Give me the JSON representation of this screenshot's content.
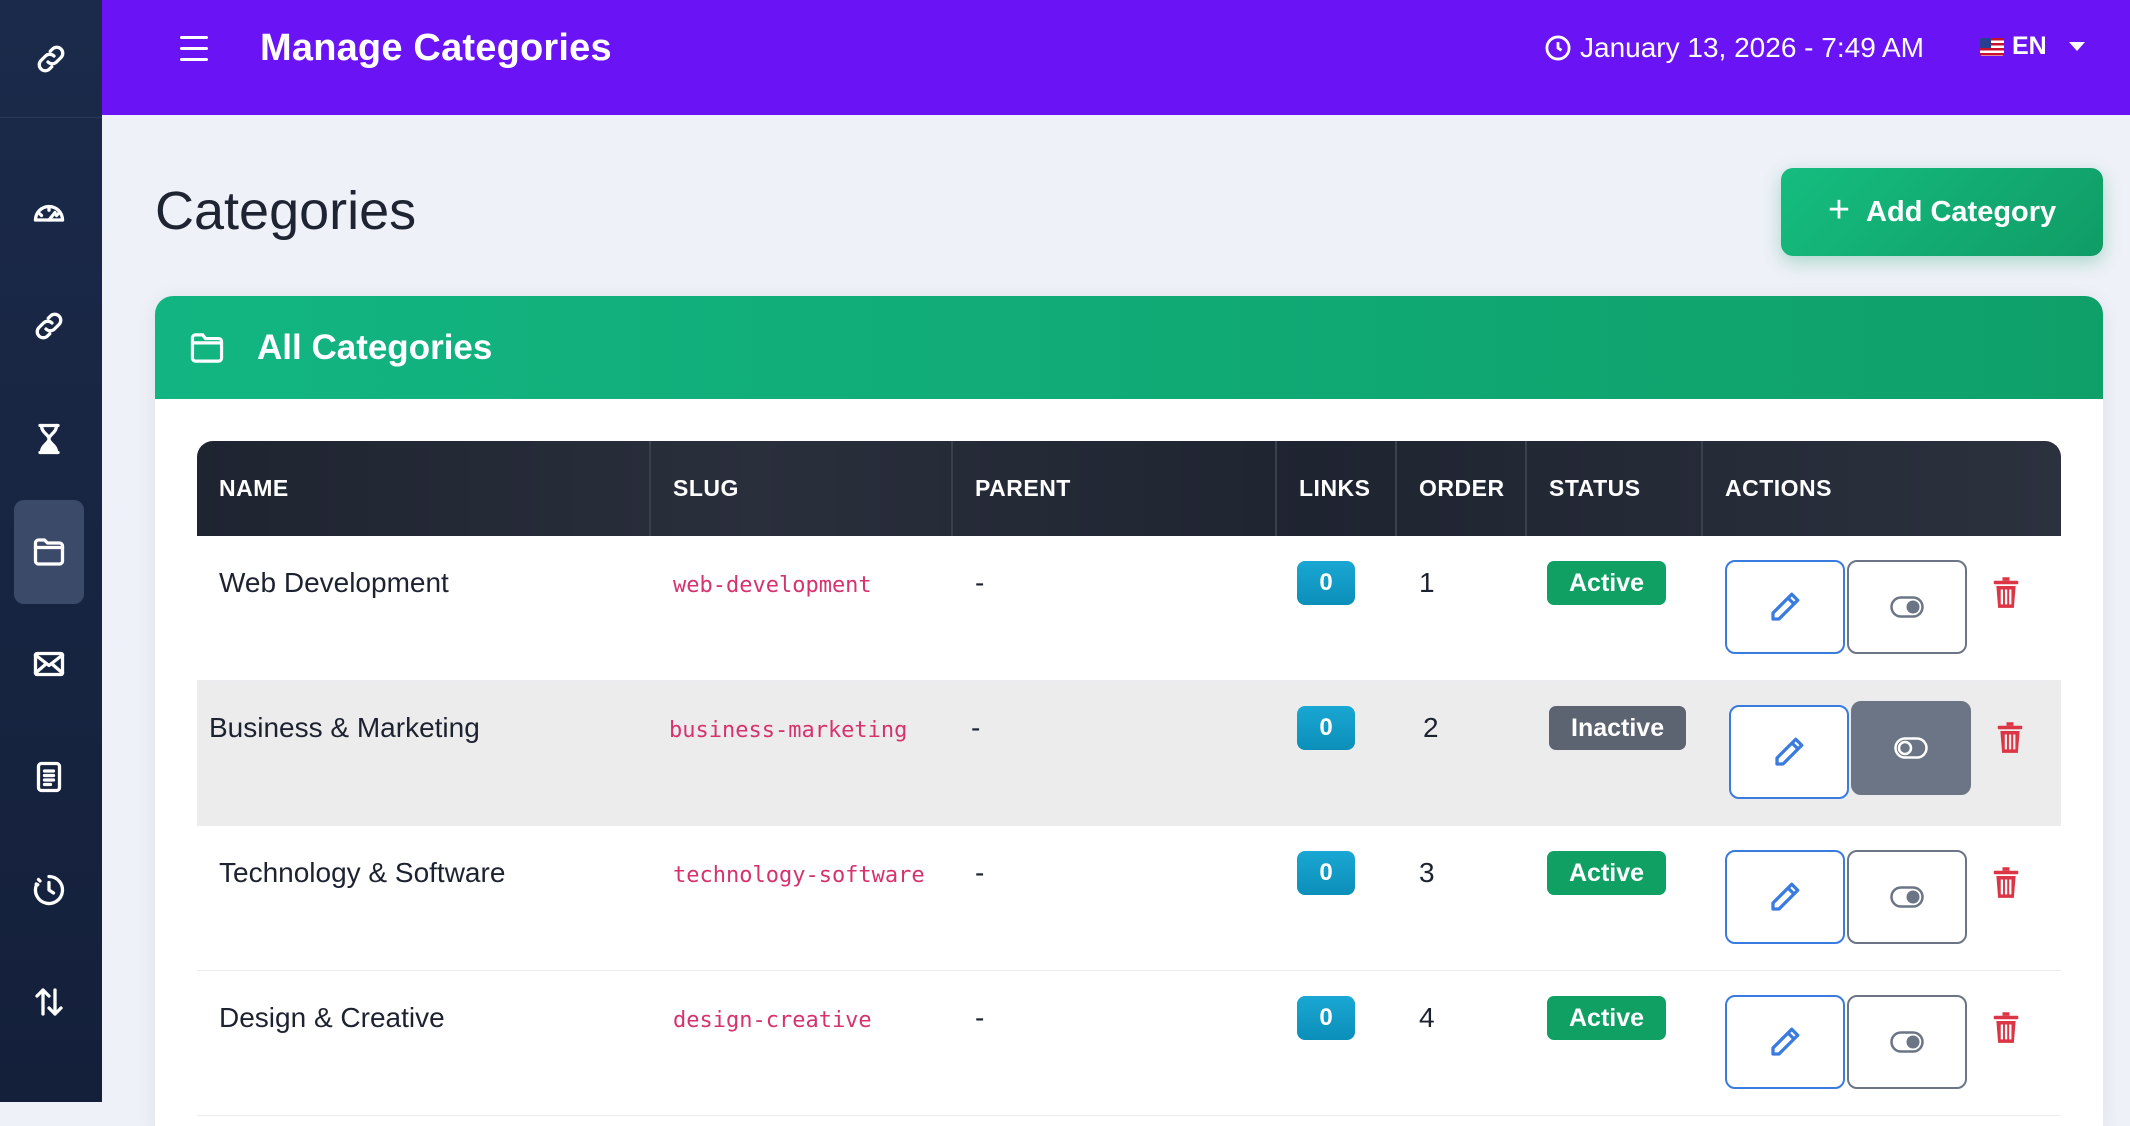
{
  "topbar": {
    "title": "Manage Categories",
    "datetime": "January 13, 2026 - 7:49 AM",
    "language": "EN"
  },
  "sidebar": {
    "items": [
      {
        "icon": "link-icon"
      },
      {
        "icon": "dashboard-icon"
      },
      {
        "icon": "link-icon"
      },
      {
        "icon": "hourglass-icon"
      },
      {
        "icon": "folder-icon",
        "active": true
      },
      {
        "icon": "envelope-icon"
      },
      {
        "icon": "document-icon"
      },
      {
        "icon": "clock-history-icon"
      },
      {
        "icon": "sort-arrows-icon"
      }
    ]
  },
  "main": {
    "heading": "Categories",
    "add_button_label": "Add Category",
    "card_title": "All Categories"
  },
  "table": {
    "columns": [
      "NAME",
      "SLUG",
      "PARENT",
      "LINKS",
      "ORDER",
      "STATUS",
      "ACTIONS"
    ],
    "rows": [
      {
        "name": "Web Development",
        "slug": "web-development",
        "parent": "-",
        "links": "0",
        "order": "1",
        "status": "Active"
      },
      {
        "name": "Business & Marketing",
        "slug": "business-marketing",
        "parent": "-",
        "links": "0",
        "order": "2",
        "status": "Inactive"
      },
      {
        "name": "Technology & Software",
        "slug": "technology-software",
        "parent": "-",
        "links": "0",
        "order": "3",
        "status": "Active"
      },
      {
        "name": "Design & Creative",
        "slug": "design-creative",
        "parent": "-",
        "links": "0",
        "order": "4",
        "status": "Active"
      }
    ]
  },
  "colors": {
    "topbar": "#6a13f5",
    "accent_green": "#10a064",
    "badge_blue": "#0b8fb9",
    "slug_pink": "#d6336c",
    "danger": "#dc3545"
  }
}
